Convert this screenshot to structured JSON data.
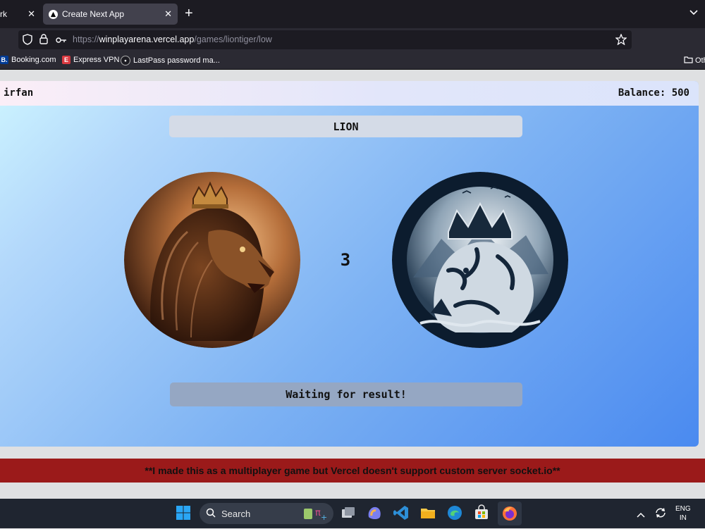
{
  "browser": {
    "tabs": [
      {
        "label": "rk"
      },
      {
        "label": "Create Next App"
      }
    ],
    "url_prefix": "https://",
    "url_host": "winplayarena.vercel.app",
    "url_path": "/games/liontiger/low",
    "bookmarks": [
      "Booking.com",
      "Express VPN",
      "LastPass password ma...",
      "Oth"
    ]
  },
  "game": {
    "username": "irfan",
    "balance": "Balance: 500",
    "selected_side": "LION",
    "countdown": "3",
    "status": "Waiting for result!"
  },
  "footer": {
    "note": "**I made this as a multiplayer game but Vercel doesn't support custom server socket.io**"
  },
  "taskbar": {
    "search_label": "Search",
    "lang_line1": "ENG",
    "lang_line2": "IN"
  },
  "colors": {
    "footer_bg": "#9b1a1a",
    "page_gradient_end": "#4a8af0",
    "browser_chrome": "#1c1b22"
  }
}
